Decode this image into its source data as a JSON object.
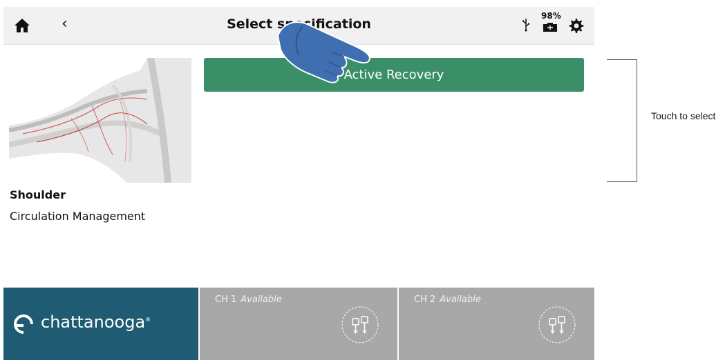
{
  "topbar": {
    "title": "Select specification",
    "battery_percent": "98%",
    "icons": [
      "home-icon",
      "back-chevron-icon",
      "usb-icon",
      "battery-icon",
      "gear-icon"
    ]
  },
  "body_region": {
    "region": "Shoulder",
    "mode": "Circulation Management"
  },
  "specifications": [
    {
      "label": "Active Recovery"
    }
  ],
  "brand": {
    "name": "chattanooga",
    "mark": "®"
  },
  "channels": [
    {
      "id": "CH 1",
      "status": "Available"
    },
    {
      "id": "CH 2",
      "status": "Available"
    }
  ],
  "annotation": {
    "callout": "Touch to select"
  },
  "colors": {
    "accent_green": "#3b8f68",
    "brand_teal": "#1f5b72",
    "channel_gray": "#a8a8a8",
    "hand_blue": "#3f6fb0"
  }
}
